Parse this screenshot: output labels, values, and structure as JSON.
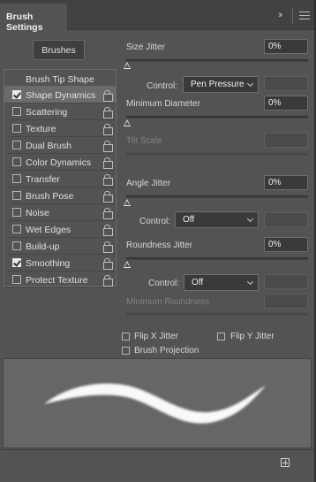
{
  "panel": {
    "tab_title": "Brush Settings"
  },
  "brushes_button": "Brushes",
  "tip_list": {
    "header": "Brush Tip Shape",
    "items": [
      {
        "label": "Shape Dynamics",
        "checked": true,
        "selected": true
      },
      {
        "label": "Scattering",
        "checked": false
      },
      {
        "label": "Texture",
        "checked": false
      },
      {
        "label": "Dual Brush",
        "checked": false
      },
      {
        "label": "Color Dynamics",
        "checked": false
      },
      {
        "label": "Transfer",
        "checked": false
      },
      {
        "label": "Brush Pose",
        "checked": false
      },
      {
        "label": "Noise",
        "checked": false
      },
      {
        "label": "Wet Edges",
        "checked": false
      },
      {
        "label": "Build-up",
        "checked": false
      },
      {
        "label": "Smoothing",
        "checked": true
      },
      {
        "label": "Protect Texture",
        "checked": false
      }
    ]
  },
  "settings": {
    "size_jitter": {
      "label": "Size Jitter",
      "value": "0%",
      "slider_fraction": 0
    },
    "size_control": {
      "label": "Control:",
      "value": "Pen Pressure"
    },
    "min_diameter": {
      "label": "Minimum Diameter",
      "value": "0%",
      "slider_fraction": 0
    },
    "tilt_scale": {
      "label": "Tilt Scale"
    },
    "angle_jitter": {
      "label": "Angle Jitter",
      "value": "0%",
      "slider_fraction": 0
    },
    "angle_control": {
      "label": "Control:",
      "value": "Off"
    },
    "roundness_jitter": {
      "label": "Roundness Jitter",
      "value": "0%",
      "slider_fraction": 0
    },
    "roundness_control": {
      "label": "Control:",
      "value": "Off"
    },
    "min_roundness": {
      "label": "Minimum Roundness"
    }
  },
  "options": {
    "flip_x": {
      "label": "Flip X Jitter",
      "checked": false
    },
    "flip_y": {
      "label": "Flip Y Jitter",
      "checked": false
    },
    "projection": {
      "label": "Brush Projection",
      "checked": false
    }
  },
  "icons": {
    "collapse": "double-chevron-right-icon",
    "menu": "hamburger-menu-icon",
    "lock": "lock-icon",
    "new_brush": "create-new-brush-icon"
  },
  "colors": {
    "panel_bg": "#535353",
    "title_bg": "#424242",
    "field_bg": "#3a3a3a",
    "stroke": "#ffffff"
  }
}
